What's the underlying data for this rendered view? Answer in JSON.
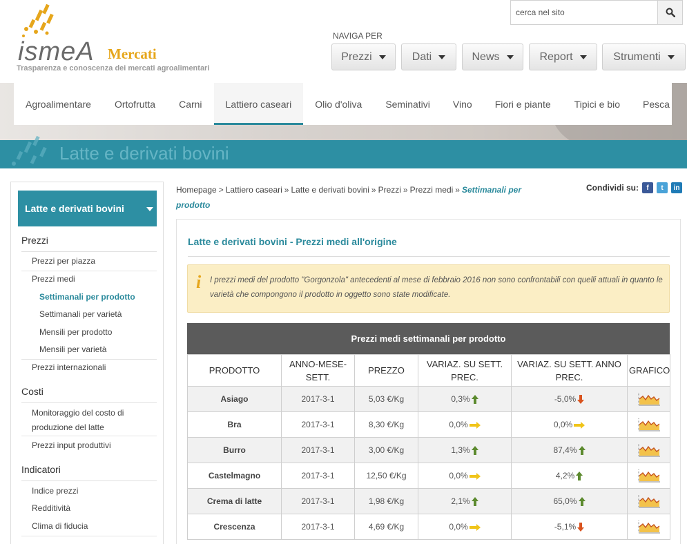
{
  "header": {
    "logo_word": "ismeA",
    "logo_mercati": "Mercati",
    "tagline": "Trasparenza e conoscenza dei mercati agroalimentari",
    "search_placeholder": "cerca nel sito",
    "naviga_label": "NAVIGA PER",
    "top_menu": [
      "Prezzi",
      "Dati",
      "News",
      "Report",
      "Strumenti"
    ]
  },
  "category_nav": {
    "items": [
      "Agroalimentare",
      "Ortofrutta",
      "Carni",
      "Lattiero caseari",
      "Olio d'oliva",
      "Seminativi",
      "Vino",
      "Fiori e piante",
      "Tipici e bio",
      "Pesca"
    ],
    "active": "Lattiero caseari"
  },
  "page_title": "Latte e derivati bovini",
  "sidebar": {
    "head": "Latte e derivati bovini",
    "sections": [
      {
        "title": "Prezzi"
      },
      {
        "title": "Costi"
      },
      {
        "title": "Indicatori"
      }
    ],
    "prezzi_items": [
      "Prezzi per piazza",
      "Prezzi medi",
      "Settimanali per prodotto",
      "Settimanali per varietà",
      "Mensili per prodotto",
      "Mensili per varietà",
      "Prezzi internazionali"
    ],
    "costi_items": [
      "Monitoraggio del costo di produzione del latte",
      "Prezzi input produttivi"
    ],
    "indicatori_items": [
      "Indice prezzi",
      "Redditività",
      "Clima di fiducia"
    ]
  },
  "breadcrumb": {
    "items": [
      "Homepage",
      "Lattiero caseari",
      "Latte e derivati bovini",
      "Prezzi",
      "Prezzi medi"
    ],
    "separator": "»",
    "first_separator": ">",
    "current": "Settimanali per prodotto"
  },
  "share": {
    "label": "Condividi su:",
    "networks": [
      "facebook-icon",
      "twitter-icon",
      "linkedin-icon"
    ]
  },
  "panel": {
    "title": "Latte e derivati bovini - Prezzi medi all'origine",
    "notice": "I prezzi medi del prodotto \"Gorgonzola\" antecedenti al mese di febbraio 2016 non sono confrontabili con quelli attuali in quanto le varietà che compongono il prodotto in oggetto sono state modificate."
  },
  "table": {
    "caption": "Prezzi medi settimanali per prodotto",
    "columns": [
      "PRODOTTO",
      "ANNO-MESE-SETT.",
      "PREZZO",
      "VARIAZ. SU SETT. PREC.",
      "VARIAZ. SU SETT. ANNO PREC.",
      "GRAFICO"
    ],
    "rows": [
      {
        "prodotto": "Asiago",
        "periodo": "2017-3-1",
        "prezzo": "5,03 €/Kg",
        "var_sett": "0,3%",
        "var_sett_dir": "up",
        "var_anno": "-5,0%",
        "var_anno_dir": "down"
      },
      {
        "prodotto": "Bra",
        "periodo": "2017-3-1",
        "prezzo": "8,30 €/Kg",
        "var_sett": "0,0%",
        "var_sett_dir": "flat",
        "var_anno": "0,0%",
        "var_anno_dir": "flat"
      },
      {
        "prodotto": "Burro",
        "periodo": "2017-3-1",
        "prezzo": "3,00 €/Kg",
        "var_sett": "1,3%",
        "var_sett_dir": "up",
        "var_anno": "87,4%",
        "var_anno_dir": "up"
      },
      {
        "prodotto": "Castelmagno",
        "periodo": "2017-3-1",
        "prezzo": "12,50 €/Kg",
        "var_sett": "0,0%",
        "var_sett_dir": "flat",
        "var_anno": "4,2%",
        "var_anno_dir": "up"
      },
      {
        "prodotto": "Crema di latte",
        "periodo": "2017-3-1",
        "prezzo": "1,98 €/Kg",
        "var_sett": "2,1%",
        "var_sett_dir": "up",
        "var_anno": "65,0%",
        "var_anno_dir": "up"
      },
      {
        "prodotto": "Crescenza",
        "periodo": "2017-3-1",
        "prezzo": "4,69 €/Kg",
        "var_sett": "0,0%",
        "var_sett_dir": "flat",
        "var_anno": "-5,1%",
        "var_anno_dir": "down"
      }
    ]
  },
  "colors": {
    "teal": "#2d8fa3",
    "link": "#2b8a9c",
    "up": "#5c8a2e",
    "down": "#d9531e",
    "flat": "#f0c419",
    "notice_bg": "#fbeec5"
  }
}
